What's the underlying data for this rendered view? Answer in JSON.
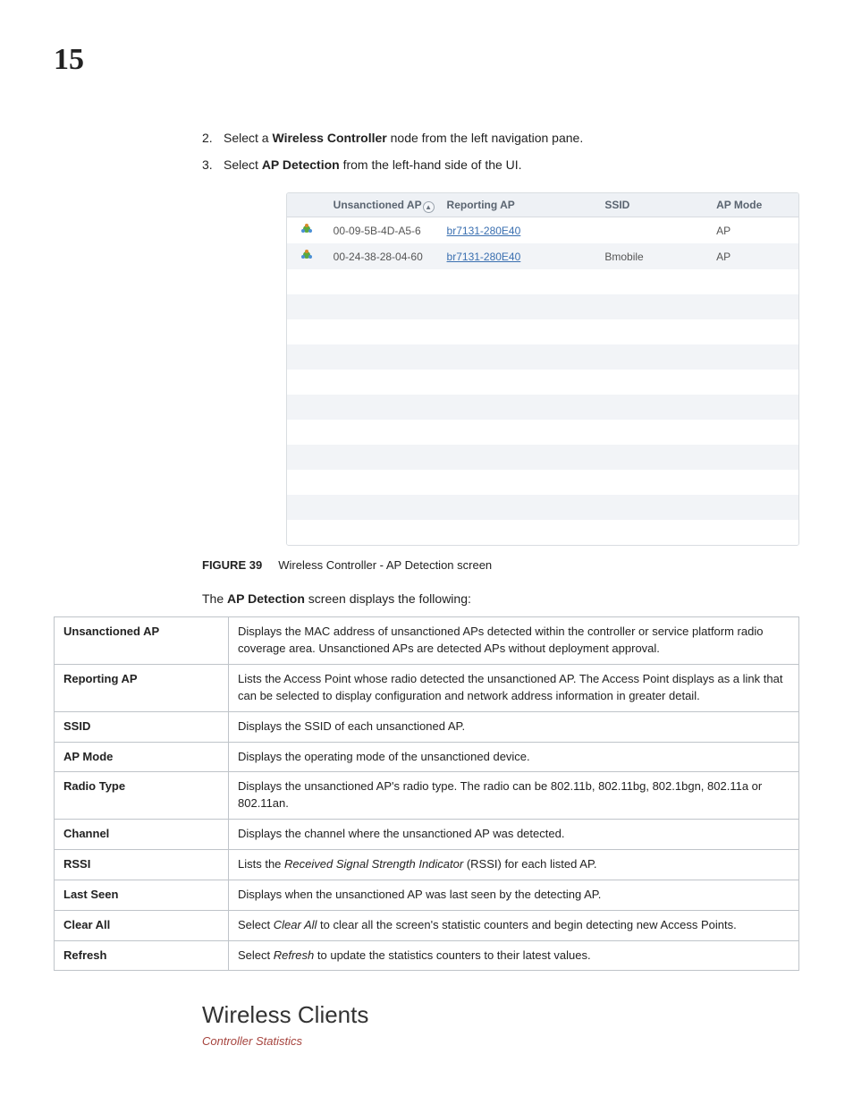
{
  "page_number": "15",
  "steps": [
    {
      "num": "2.",
      "pre": "Select a ",
      "bold": "Wireless Controller",
      "post": " node from the left navigation pane."
    },
    {
      "num": "3.",
      "pre": "Select ",
      "bold": "AP Detection",
      "post": " from the left-hand side of the UI."
    }
  ],
  "shot": {
    "headers": [
      "",
      "Unsanctioned AP",
      "Reporting AP",
      "SSID",
      "AP Mode"
    ],
    "sort_on_col": 1,
    "rows": [
      {
        "icon": true,
        "mac": "00-09-5B-4D-A5-6",
        "reporting": "br7131-280E40",
        "ssid": "",
        "mode": "AP"
      },
      {
        "icon": true,
        "mac": "00-24-38-28-04-60",
        "reporting": "br7131-280E40",
        "ssid": "Bmobile",
        "mode": "AP"
      }
    ],
    "empty_rows": 11
  },
  "figure": {
    "label": "FIGURE 39",
    "caption": "Wireless Controller - AP Detection screen"
  },
  "intro": {
    "pre": "The ",
    "bold": "AP Detection",
    "post": " screen displays the following:"
  },
  "fields": [
    {
      "term": "Unsanctioned AP",
      "desc": "Displays the MAC address of unsanctioned APs detected within the controller or service platform radio coverage area. Unsanctioned APs are detected APs without deployment approval."
    },
    {
      "term": "Reporting AP",
      "desc": "Lists the Access Point whose radio detected the unsanctioned AP. The Access Point displays as a link that can be selected to display configuration and network address information in greater detail."
    },
    {
      "term": "SSID",
      "desc": "Displays the SSID of each unsanctioned AP."
    },
    {
      "term": "AP Mode",
      "desc": "Displays the operating mode of the unsanctioned device."
    },
    {
      "term": "Radio Type",
      "desc": "Displays the unsanctioned AP's radio type. The radio can be 802.11b, 802.11bg, 802.1bgn, 802.11a or 802.11an."
    },
    {
      "term": "Channel",
      "desc": "Displays the channel where the unsanctioned AP was detected."
    },
    {
      "term": "RSSI",
      "desc_html": "Lists the <i>Received Signal Strength Indicator</i> (RSSI) for each listed AP."
    },
    {
      "term": "Last Seen",
      "desc": "Displays when the unsanctioned AP was last seen by the detecting AP."
    },
    {
      "term": "Clear All",
      "desc_html": "Select <i>Clear All</i> to clear all the screen's statistic counters and begin detecting new Access Points."
    },
    {
      "term": "Refresh",
      "desc_html": "Select <i>Refresh</i> to update the statistics counters to their latest values."
    }
  ],
  "section_heading": "Wireless Clients",
  "breadcrumb": "Controller Statistics"
}
